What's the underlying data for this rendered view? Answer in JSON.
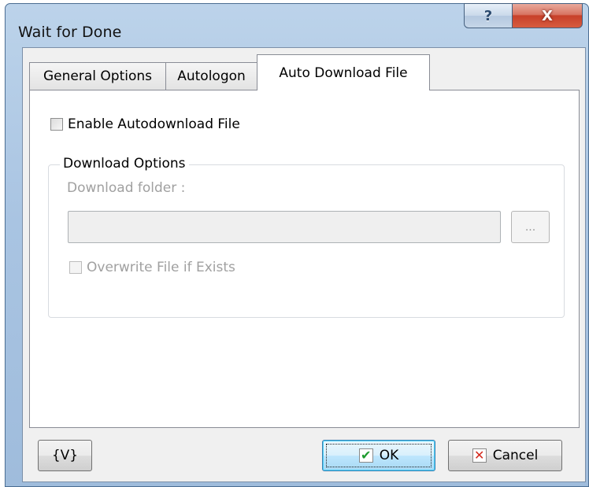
{
  "window": {
    "title": "Wait for Done"
  },
  "caption_buttons": {
    "help": "?",
    "close": "X"
  },
  "tabs": [
    {
      "label": "General Options",
      "active": false
    },
    {
      "label": "Autologon",
      "active": false
    },
    {
      "label": "Auto Download File",
      "active": true
    }
  ],
  "page": {
    "enable_label": "Enable Autodownload File",
    "enable_checked": false,
    "group": {
      "legend": "Download Options",
      "folder_label": "Download folder :",
      "folder_value": "",
      "browse_label": "...",
      "overwrite_label": "Overwrite File if Exists",
      "overwrite_checked": false
    }
  },
  "buttons": {
    "variables": "{V}",
    "ok": "OK",
    "cancel": "Cancel"
  },
  "icons": {
    "ok": "checkmark-icon",
    "cancel": "x-icon"
  },
  "colors": {
    "title_bar": "#a9c4e2",
    "close_button": "#c7402a",
    "ok_check": "#1e9b2f",
    "cancel_x": "#d42a1e"
  }
}
